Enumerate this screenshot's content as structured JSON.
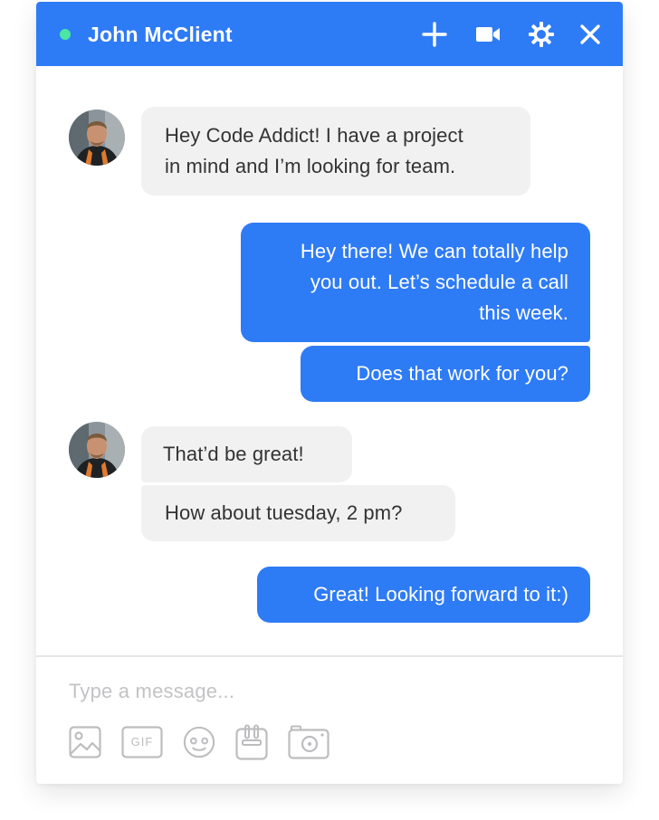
{
  "header": {
    "contact_name": "John McClient",
    "status": "online",
    "status_color": "#4CE6A3",
    "accent_color": "#2E7BF6",
    "actions": [
      "plus-icon",
      "video-camera-icon",
      "settings-icon",
      "close-icon"
    ]
  },
  "messages": [
    {
      "direction": "incoming",
      "text_lines": [
        "Hey Code Addict! I have a project",
        "in mind and I’m looking for team."
      ]
    },
    {
      "direction": "outgoing",
      "text_lines": [
        "Hey there! We can totally help",
        "you out. Let’s schedule a call",
        "this week."
      ]
    },
    {
      "direction": "outgoing",
      "text_lines": [
        "Does that work for you?"
      ]
    },
    {
      "direction": "incoming",
      "text_lines": [
        "That’d be great!"
      ]
    },
    {
      "direction": "incoming",
      "text_lines": [
        "How about tuesday, 2 pm?"
      ]
    },
    {
      "direction": "outgoing",
      "text_lines": [
        "Great! Looking forward to it:)"
      ]
    }
  ],
  "composer": {
    "placeholder": "Type a message...",
    "value": "",
    "tools": [
      "image-icon",
      "gif-icon",
      "emoji-icon",
      "sticker-icon",
      "camera-icon"
    ],
    "gif_label": "GIF"
  }
}
